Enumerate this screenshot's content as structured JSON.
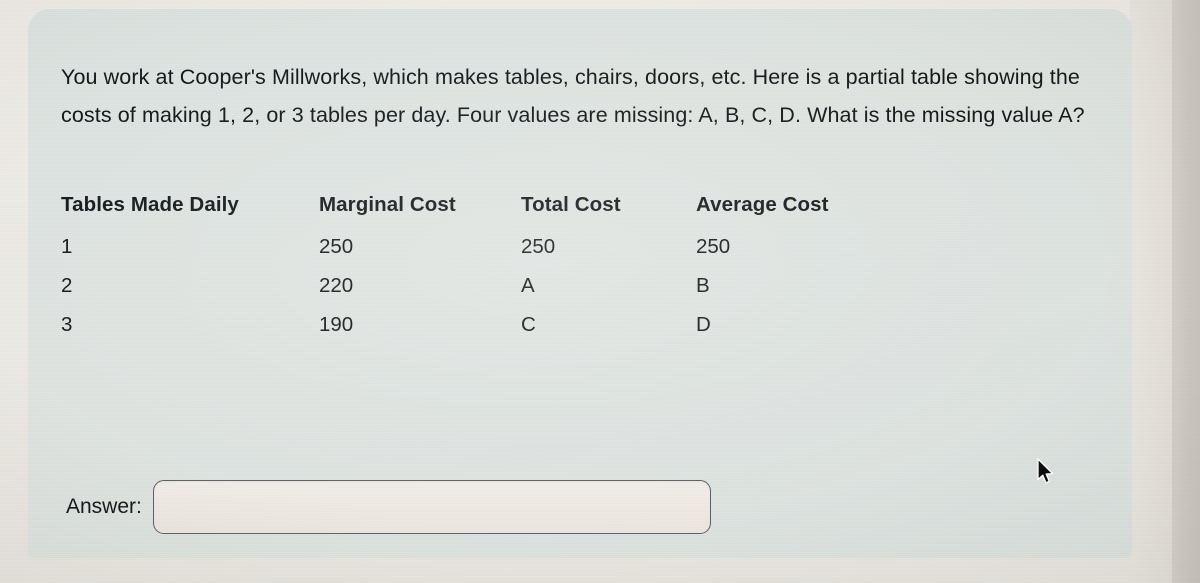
{
  "prompt": {
    "text": "You work at Cooper's Millworks, which makes tables, chairs, doors, etc. Here is a partial table showing the costs of making 1, 2, or 3 tables per day. Four values are missing: A, B, C, D. What is the missing value A?"
  },
  "table": {
    "headers": [
      "Tables Made Daily",
      "Marginal Cost",
      "Total Cost",
      "Average Cost"
    ],
    "rows": [
      [
        "1",
        "250",
        "250",
        "250"
      ],
      [
        "2",
        "220",
        "A",
        "B"
      ],
      [
        "3",
        "190",
        "C",
        "D"
      ]
    ]
  },
  "answer": {
    "label": "Answer:",
    "value": "",
    "placeholder": ""
  },
  "cursor": {
    "icon": "arrow-pointer-icon"
  },
  "colors": {
    "card_background": "#dfe4e1",
    "page_background": "#eceae4",
    "bezel": "#cdc8c1",
    "text": "#15181b",
    "input_background": "#efeae3",
    "input_border": "#5f6266"
  }
}
